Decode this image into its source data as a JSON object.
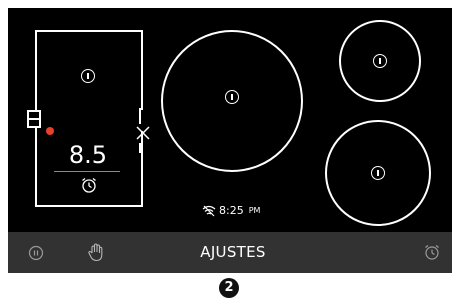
{
  "cooktop": {
    "bridge_zone": {
      "power_level": "8.5",
      "active_indicator_color": "#e8402b"
    },
    "icons": {
      "zone_info": "info-icon",
      "bridge": "bridge-zone-icon",
      "close": "close-icon",
      "timer": "alarm-clock-icon",
      "wifi": "wifi-icon"
    },
    "status": {
      "time": "8:25",
      "period": "PM"
    }
  },
  "bottom_bar": {
    "label": "AJUSTES",
    "pause_icon": "pause-icon",
    "lock_icon": "hand-lock-icon",
    "timer_icon": "alarm-clock-icon",
    "background": "#323232"
  },
  "step_badge": "2"
}
